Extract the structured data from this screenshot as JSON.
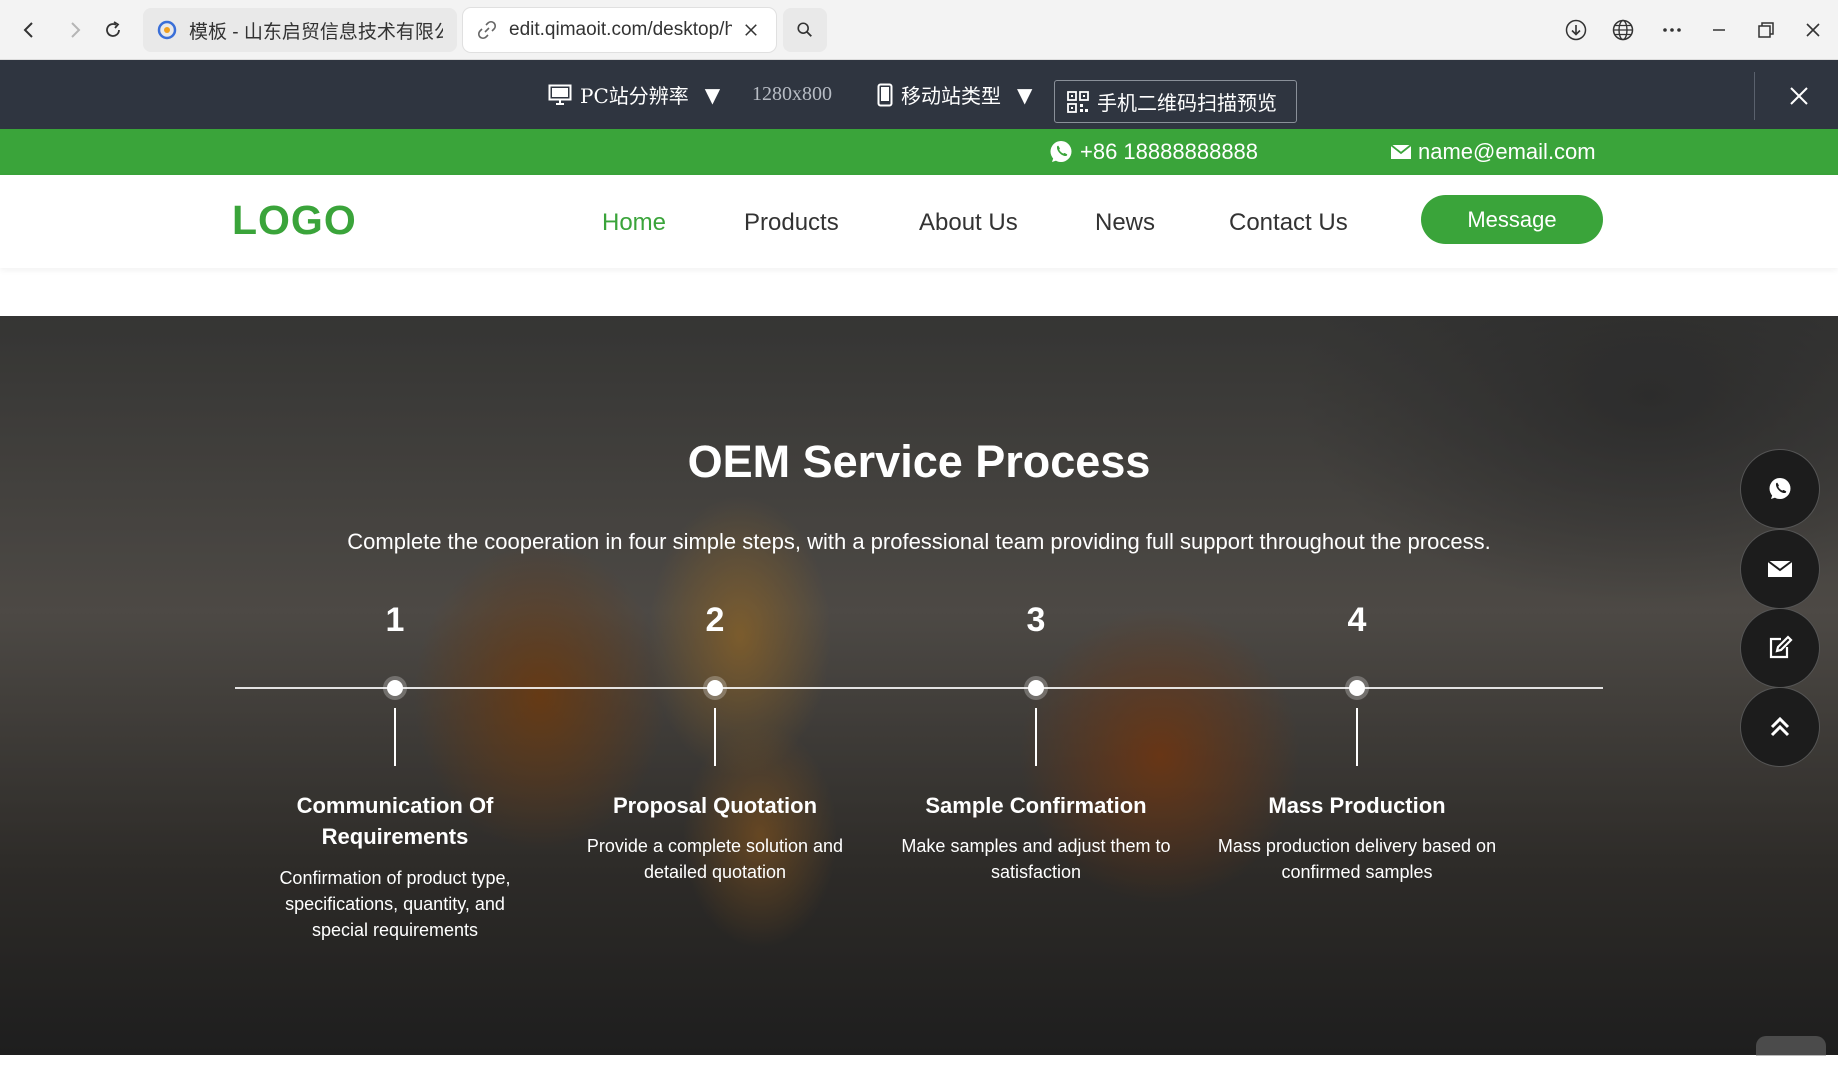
{
  "browser": {
    "tabs": [
      {
        "label": "模板 - 山东启贸信息技术有限公司",
        "active": false
      },
      {
        "label": "edit.qimaoit.com/desktop/h",
        "active": true
      }
    ]
  },
  "preview_toolbar": {
    "pc_resolution_label": "PC站分辨率",
    "resolution_value": "1280x800",
    "mobile_type_label": "移动站类型",
    "qr_preview_label": "手机二维码扫描预览"
  },
  "topbar": {
    "phone": "+86 18888888888",
    "email": "name@email.com",
    "color": "#3aa43a"
  },
  "header": {
    "logo": "LOGO",
    "nav": [
      {
        "label": "Home",
        "active": true
      },
      {
        "label": "Products",
        "active": false
      },
      {
        "label": "About Us",
        "active": false
      },
      {
        "label": "News",
        "active": false
      },
      {
        "label": "Contact Us",
        "active": false
      }
    ],
    "message_button": "Message",
    "accent_color": "#3aa43a"
  },
  "hero": {
    "title": "OEM Service Process",
    "subtitle": "Complete the cooperation in four simple steps, with a professional team providing full support throughout the process.",
    "steps": [
      {
        "number": "1",
        "title": "Communication Of Requirements",
        "description": "Confirmation of product type, specifications, quantity, and special requirements"
      },
      {
        "number": "2",
        "title": "Proposal Quotation",
        "description": "Provide a complete solution and detailed quotation"
      },
      {
        "number": "3",
        "title": "Sample Confirmation",
        "description": "Make samples and adjust them to satisfaction"
      },
      {
        "number": "4",
        "title": "Mass Production",
        "description": "Mass production delivery based on confirmed samples"
      }
    ]
  },
  "floating_buttons": [
    "whatsapp-icon",
    "mail-icon",
    "edit-icon",
    "back-to-top-icon"
  ]
}
